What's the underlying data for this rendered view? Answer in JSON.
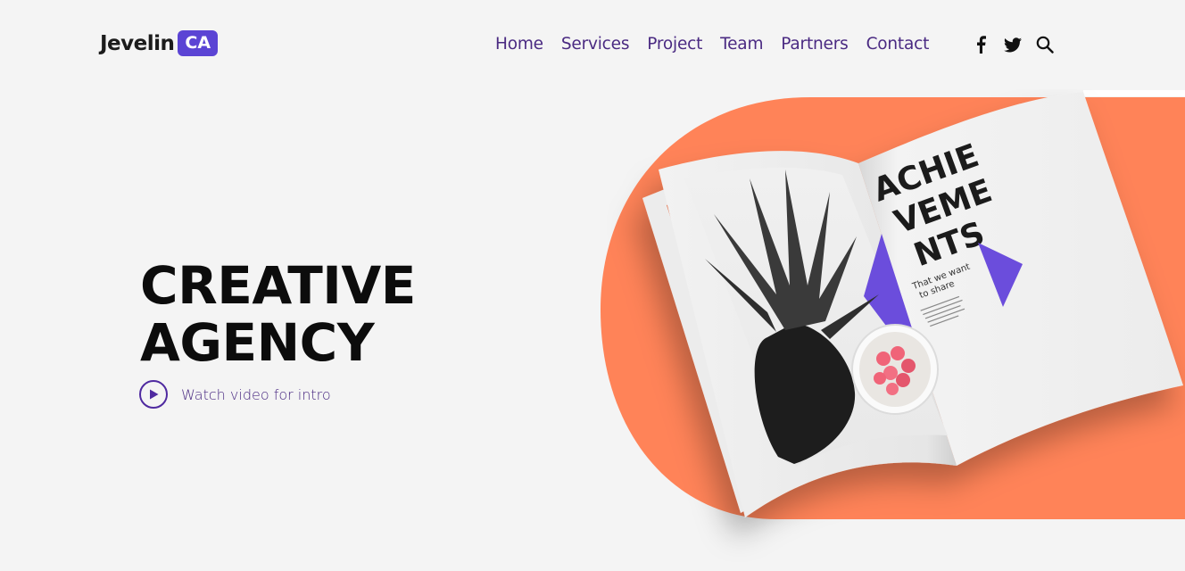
{
  "header": {
    "logo": {
      "text": "Jevelin",
      "badge": "CA"
    },
    "nav": [
      {
        "label": "Home"
      },
      {
        "label": "Services"
      },
      {
        "label": "Project"
      },
      {
        "label": "Team"
      },
      {
        "label": "Partners"
      },
      {
        "label": "Contact"
      }
    ],
    "icons": [
      "facebook-icon",
      "twitter-icon",
      "search-icon"
    ]
  },
  "hero": {
    "title_line1": "CREATIVE",
    "title_line2": "AGENCY",
    "watch_label": "Watch video for intro",
    "magazine": {
      "heading_lines": [
        "ACHIE",
        "VEME",
        "NTS"
      ],
      "subtitle_lines": [
        "That we want",
        "to share"
      ]
    }
  },
  "colors": {
    "accent_orange": "#ff8358",
    "brand_purple": "#5b44d4",
    "nav_text": "#4a2a82",
    "background": "#f4f4f4"
  }
}
